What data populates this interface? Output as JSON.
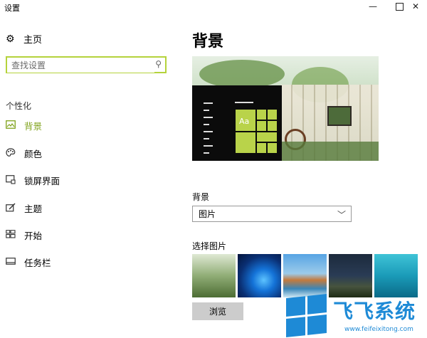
{
  "window": {
    "title": "设置",
    "minimize": "—",
    "close": "✕"
  },
  "sidebar": {
    "home_label": "主页",
    "search": {
      "placeholder": "查找设置"
    },
    "section_label": "个性化",
    "items": [
      {
        "label": "背景",
        "icon": "picture-icon",
        "active": true
      },
      {
        "label": "颜色",
        "icon": "palette-icon",
        "active": false
      },
      {
        "label": "锁屏界面",
        "icon": "lockscreen-icon",
        "active": false
      },
      {
        "label": "主题",
        "icon": "theme-icon",
        "active": false
      },
      {
        "label": "开始",
        "icon": "start-icon",
        "active": false
      },
      {
        "label": "任务栏",
        "icon": "taskbar-icon",
        "active": false
      }
    ]
  },
  "main": {
    "title": "背景",
    "preview": {
      "tile_text": "Aa"
    },
    "background_label": "背景",
    "background_select": "图片",
    "choose_picture_label": "选择图片",
    "browse_label": "浏览"
  },
  "watermark": {
    "brand": "飞飞系统",
    "url": "www.feifeixitong.com"
  },
  "colors": {
    "accent": "#7fa21a",
    "search_border": "#b5d33c",
    "tile": "#a6c22c",
    "watermark": "#1e8ad6"
  }
}
